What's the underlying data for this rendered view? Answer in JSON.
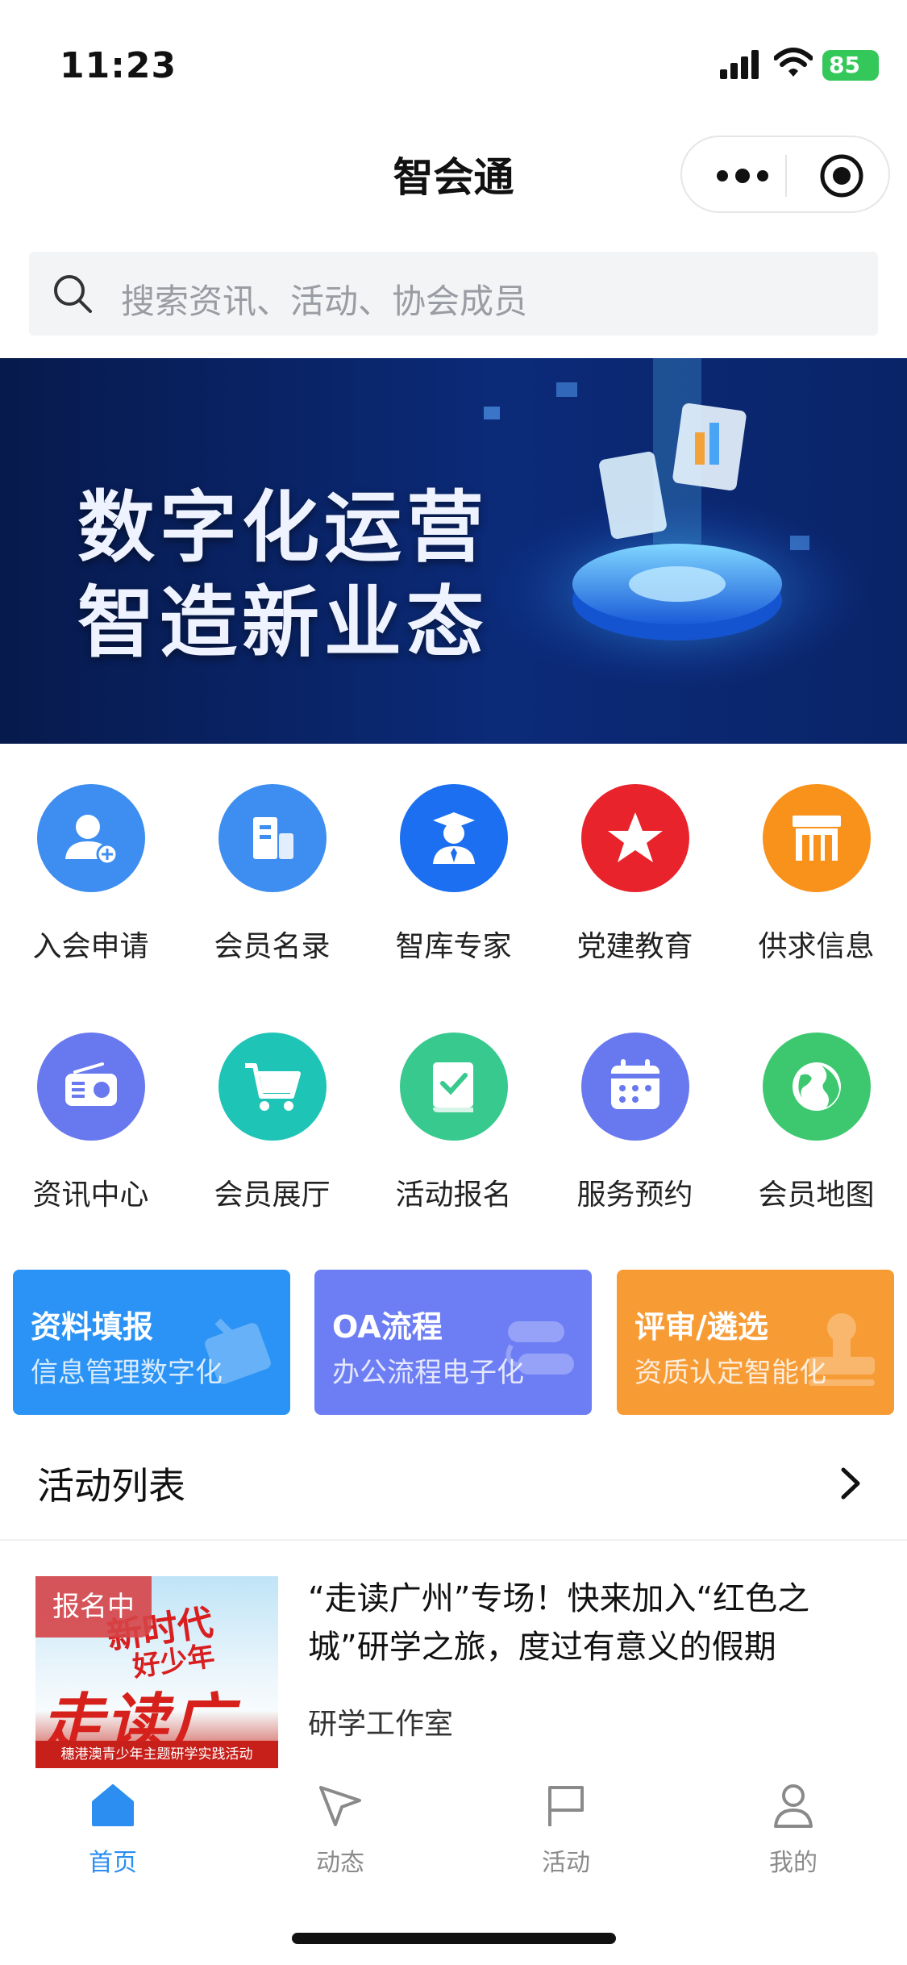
{
  "status_bar": {
    "time": "11:23",
    "battery": "85"
  },
  "nav": {
    "title": "智会通"
  },
  "search": {
    "placeholder": "搜索资讯、活动、协会成员"
  },
  "banner": {
    "line1": "数字化运营",
    "line2": "智造新业态"
  },
  "grid": [
    {
      "label": "入会申请",
      "icon": "add-member-icon",
      "color": "#3d8ef0"
    },
    {
      "label": "会员名录",
      "icon": "building-icon",
      "color": "#3d8ef0"
    },
    {
      "label": "智库专家",
      "icon": "expert-icon",
      "color": "#1b6ff0"
    },
    {
      "label": "党建教育",
      "icon": "star-icon",
      "color": "#e8232c"
    },
    {
      "label": "供求信息",
      "icon": "shop-icon",
      "color": "#f8921a"
    },
    {
      "label": "资讯中心",
      "icon": "radio-icon",
      "color": "#6878ee"
    },
    {
      "label": "会员展厅",
      "icon": "cart-icon",
      "color": "#1ec4b6"
    },
    {
      "label": "活动报名",
      "icon": "checklist-book-icon",
      "color": "#38c98e"
    },
    {
      "label": "服务预约",
      "icon": "calendar-icon",
      "color": "#6878ee"
    },
    {
      "label": "会员地图",
      "icon": "globe-icon",
      "color": "#3dc870"
    }
  ],
  "cards": [
    {
      "title": "资料填报",
      "subtitle": "信息管理数字化",
      "color": "#2b93f5"
    },
    {
      "title": "OA流程",
      "subtitle": "办公流程电子化",
      "color": "#6d7ef5"
    },
    {
      "title": "评审/遴选",
      "subtitle": "资质认定智能化",
      "color": "#f79b35"
    }
  ],
  "section": {
    "title": "活动列表"
  },
  "activity": {
    "badge": "报名中",
    "title": "“走读广州”专场！快来加入“红色之城”研学之旅，度过有意义的假期",
    "org": "研学工作室",
    "image_text": {
      "line1": "新时代",
      "line2": "好少年",
      "line3": "走读广州",
      "strip": "穗港澳青少年主题研学实践活动"
    }
  },
  "tabs": [
    {
      "label": "首页",
      "icon": "home-icon",
      "active": true
    },
    {
      "label": "动态",
      "icon": "send-icon",
      "active": false
    },
    {
      "label": "活动",
      "icon": "flag-icon",
      "active": false
    },
    {
      "label": "我的",
      "icon": "user-icon",
      "active": false
    }
  ]
}
